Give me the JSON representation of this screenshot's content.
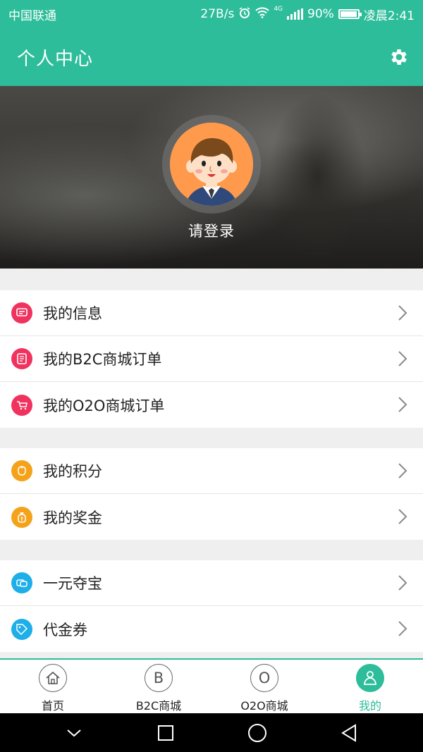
{
  "status_bar": {
    "carrier": "中国联通",
    "speed": "27B/s",
    "network": "4G",
    "battery": "90%",
    "battery_level": 0.9,
    "time": "凌晨2:41"
  },
  "header": {
    "title": "个人中心"
  },
  "profile": {
    "login_text": "请登录"
  },
  "menu_groups": [
    [
      {
        "label": "我的信息",
        "icon": "message-icon",
        "color": "#f0325f"
      },
      {
        "label": "我的B2C商城订单",
        "icon": "order-icon",
        "color": "#f0325f"
      },
      {
        "label": "我的O2O商城订单",
        "icon": "cart-icon",
        "color": "#f0325f"
      }
    ],
    [
      {
        "label": "我的积分",
        "icon": "points-icon",
        "color": "#f5a21b"
      },
      {
        "label": "我的奖金",
        "icon": "bonus-icon",
        "color": "#f5a21b"
      }
    ],
    [
      {
        "label": "一元夺宝",
        "icon": "treasure-icon",
        "color": "#1eaee8"
      },
      {
        "label": "代金券",
        "icon": "voucher-icon",
        "color": "#1eaee8"
      }
    ]
  ],
  "tabs": [
    {
      "label": "首页",
      "icon": "home-icon",
      "active": false
    },
    {
      "label": "B2C商城",
      "icon": "b2c-icon",
      "glyph": "B",
      "active": false
    },
    {
      "label": "O2O商城",
      "icon": "o2o-icon",
      "glyph": "O",
      "active": false
    },
    {
      "label": "我的",
      "icon": "user-icon",
      "active": true
    }
  ],
  "colors": {
    "accent": "#2ebd9a",
    "red": "#f0325f",
    "orange": "#f5a21b",
    "blue": "#1eaee8"
  }
}
